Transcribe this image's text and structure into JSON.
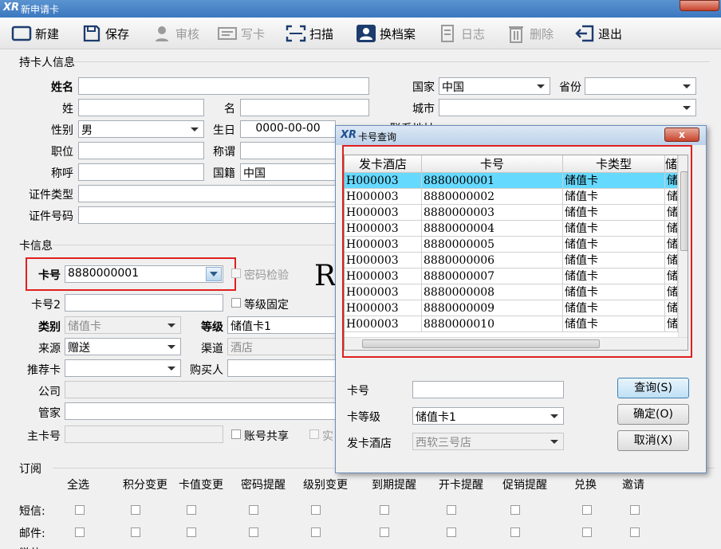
{
  "window": {
    "logo": "XR",
    "title": "新申请卡"
  },
  "toolbar": [
    {
      "label": "新建",
      "icon": "new-card-icon",
      "enabled": true
    },
    {
      "label": "保存",
      "icon": "save-icon",
      "enabled": true
    },
    {
      "label": "审核",
      "icon": "audit-icon",
      "enabled": false
    },
    {
      "label": "写卡",
      "icon": "write-card-icon",
      "enabled": false
    },
    {
      "label": "扫描",
      "icon": "scan-icon",
      "enabled": true
    },
    {
      "label": "换档案",
      "icon": "change-profile-icon",
      "enabled": true
    },
    {
      "label": "日志",
      "icon": "log-icon",
      "enabled": false
    },
    {
      "label": "删除",
      "icon": "delete-icon",
      "enabled": false
    },
    {
      "label": "退出",
      "icon": "exit-icon",
      "enabled": true
    }
  ],
  "holder": {
    "section": "持卡人信息",
    "fullname_label": "姓名",
    "fullname": "",
    "surname_label": "姓",
    "surname": "",
    "given_label": "名",
    "given": "",
    "gender_label": "性别",
    "gender": "男",
    "birthday_label": "生日",
    "birthday": "0000-00-00",
    "position_label": "职位",
    "position": "",
    "title_label": "称谓",
    "title": "",
    "salutation_label": "称呼",
    "salutation": "",
    "nationality_label": "国籍",
    "nationality": "中国",
    "idtype_label": "证件类型",
    "idtype": "",
    "idno_label": "证件号码",
    "idno": "",
    "country_label": "国家",
    "country": "中国",
    "province_label": "省份",
    "province": "",
    "city_label": "城市",
    "city": "",
    "contact_partial": "联系地址"
  },
  "card": {
    "section": "卡信息",
    "cardno_label": "卡号",
    "cardno": "8880000001",
    "pwdcheck_label": "密码检验",
    "cardno2_label": "卡号2",
    "cardno2": "",
    "fixedlevel_label": "等级固定",
    "type_label": "类别",
    "type": "储值卡",
    "level_label": "等级",
    "level": "储值卡1",
    "source_label": "来源",
    "source": "赠送",
    "channel_label": "渠道",
    "channel": "酒店",
    "referrer_label": "推荐卡",
    "referrer": "",
    "buyer_label": "购买人",
    "buyer": "",
    "company_label": "公司",
    "company": "",
    "steward_label": "管家",
    "steward": "",
    "maincard_label": "主卡号",
    "maincard": "",
    "sharedacct_label": "账号共享",
    "partial_label": "实",
    "big_letter": "R"
  },
  "subscribe": {
    "section": "订阅",
    "columns": [
      "全选",
      "积分变更",
      "卡值变更",
      "密码提醒",
      "级别变更",
      "到期提醒",
      "开卡提醒",
      "促销提醒",
      "兑换",
      "邀请"
    ],
    "rows": [
      "短信:",
      "邮件:"
    ],
    "partial_row": "微信:"
  },
  "dialog": {
    "logo": "XR",
    "title": "卡号查询",
    "close": "x",
    "columns": [
      "发卡酒店",
      "卡号",
      "卡类型"
    ],
    "partial_col": "储",
    "rows": [
      [
        "H000003",
        "8880000001",
        "储值卡"
      ],
      [
        "H000003",
        "8880000002",
        "储值卡"
      ],
      [
        "H000003",
        "8880000003",
        "储值卡"
      ],
      [
        "H000003",
        "8880000004",
        "储值卡"
      ],
      [
        "H000003",
        "8880000005",
        "储值卡"
      ],
      [
        "H000003",
        "8880000006",
        "储值卡"
      ],
      [
        "H000003",
        "8880000007",
        "储值卡"
      ],
      [
        "H000003",
        "8880000008",
        "储值卡"
      ],
      [
        "H000003",
        "8880000009",
        "储值卡"
      ],
      [
        "H000003",
        "8880000010",
        "储值卡"
      ]
    ],
    "selected_row": 0,
    "query_cardno_label": "卡号",
    "query_cardno": "",
    "query_level_label": "卡等级",
    "query_level": "储值卡1",
    "query_hotel_label": "发卡酒店",
    "query_hotel": "西软三号店",
    "btn_query": "查询(S)",
    "btn_ok": "确定(O)",
    "btn_cancel": "取消(X)"
  },
  "colors": {
    "highlight": "#66d9ff",
    "annotation": "#e02020",
    "titlebar": "#3c78c0"
  }
}
